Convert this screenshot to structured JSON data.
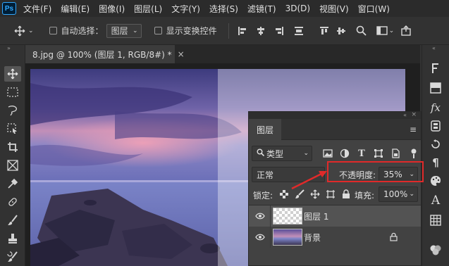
{
  "app": {
    "logo": "Ps"
  },
  "menu": [
    "文件(F)",
    "编辑(E)",
    "图像(I)",
    "图层(L)",
    "文字(Y)",
    "选择(S)",
    "滤镜(T)",
    "3D(D)",
    "视图(V)",
    "窗口(W)"
  ],
  "options": {
    "auto_select_label": "自动选择：",
    "auto_select_target": "图层",
    "show_transform_label": "显示变换控件"
  },
  "document": {
    "tab_title": "8.jpg @ 100% (图层 1, RGB/8#) *",
    "close_symbol": "×"
  },
  "layers_panel": {
    "tab_label": "图层",
    "filter_label": "类型",
    "blend_mode": "正常",
    "opacity_label": "不透明度:",
    "opacity_value": "35%",
    "opacity_fraction": 0.35,
    "lock_label": "锁定:",
    "fill_label": "填充:",
    "fill_value": "100%",
    "layers": [
      {
        "name": "图层 1",
        "selected": true,
        "thumb": "transparent"
      },
      {
        "name": "背景",
        "selected": false,
        "thumb": "photo",
        "locked": true
      }
    ]
  },
  "colors": {
    "accent": "#31a8ff",
    "highlight": "#e02a2a",
    "panel_bg": "#424242",
    "selected_row": "#535353"
  },
  "icons": {
    "tools": [
      "move-tool",
      "marquee-tool",
      "lasso-tool",
      "object-select-tool",
      "crop-tool",
      "frame-tool",
      "eyedropper-tool",
      "healing-tool",
      "brush-tool",
      "clone-stamp-tool",
      "history-brush-tool"
    ],
    "right_strip": [
      "character-icon",
      "color-icon",
      "fx-icon",
      "adjustments-icon",
      "history-icon",
      "paragraph-icon",
      "palette-icon",
      "glyphs-icon",
      "grid-icon",
      "channels-icon"
    ]
  }
}
